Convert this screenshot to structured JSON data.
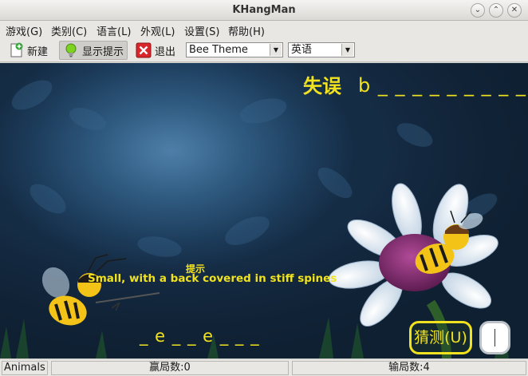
{
  "window": {
    "title": "KHangMan"
  },
  "menu": [
    "游戏(G)",
    "类别(C)",
    "语言(L)",
    "外观(L)",
    "设置(S)",
    "帮助(H)"
  ],
  "toolbar": {
    "new_label": "新建",
    "hint_label": "显示提示",
    "quit_label": "退出",
    "theme_select": "Bee Theme",
    "language_select": "英语"
  },
  "game": {
    "misses_label": "失误",
    "top_word": "b _ _ _ _ _ _ _ _ _",
    "hint_title": "提示",
    "hint_text": "Small, with a back covered in stiff spines",
    "bottom_word": "_ e _ _ e _ _ _",
    "guess_button": "猜测(U)",
    "guess_value": ""
  },
  "status": {
    "category": "Animals",
    "wins": "赢局数:0",
    "losses": "输局数:4"
  },
  "colors": {
    "text_yellow": "#f1e21f",
    "scene_blue": "#2f5a80"
  }
}
